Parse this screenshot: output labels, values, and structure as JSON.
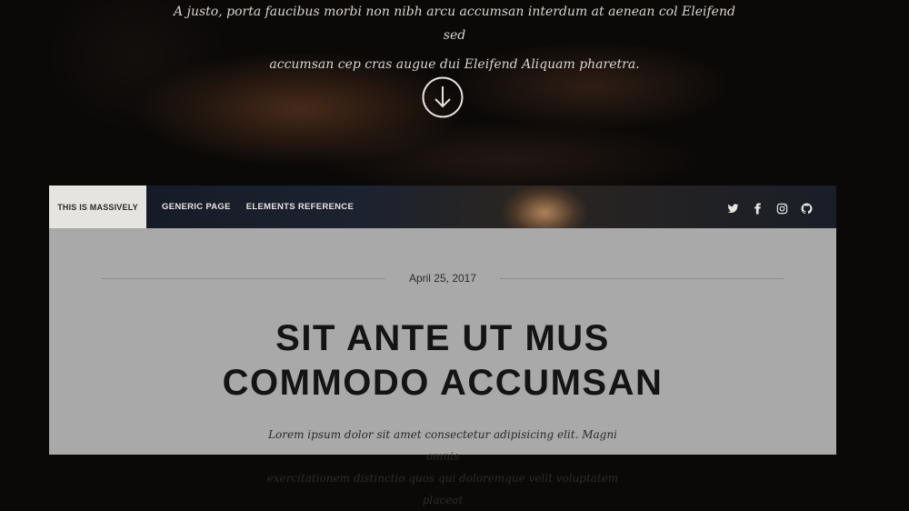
{
  "intro": {
    "text_line1": "A justo, porta faucibus morbi non nibh arcu accumsan interdum at aenean col Eleifend sed",
    "text_line2": "accumsan cep cras augue dui Eleifend Aliquam pharetra.",
    "scroll_icon": "circle-arrow-down-icon"
  },
  "nav": {
    "brand": "THIS IS MASSIVELY",
    "links": [
      "GENERIC PAGE",
      "ELEMENTS REFERENCE"
    ],
    "social_icons": [
      "twitter-icon",
      "facebook-icon",
      "instagram-icon",
      "github-icon"
    ]
  },
  "post": {
    "date": "April 25, 2017",
    "title_line1": "SIT ANTE UT MUS",
    "title_line2": "COMMODO ACCUMSAN",
    "excerpt_line1": "Lorem ipsum dolor sit amet consectetur adipisicing elit. Magni omnis",
    "excerpt_line2": "exercitationem distinctio quos qui doloremque velit voluptatem placeat"
  },
  "colors": {
    "panel_bg": "#a9a9a9",
    "brand_bg": "#e6e4e0",
    "title_text": "#141414",
    "intro_text": "#d9d4cf"
  }
}
